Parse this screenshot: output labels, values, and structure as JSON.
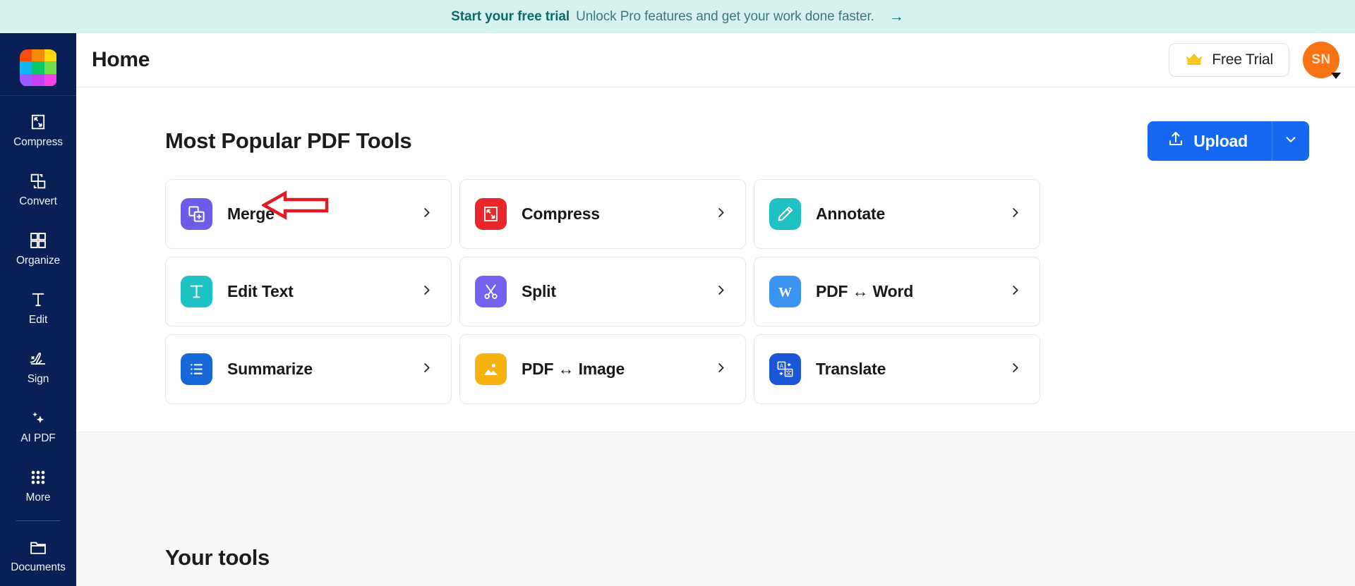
{
  "banner": {
    "strong": "Start your free trial",
    "text": "Unlock Pro features and get your work done faster.",
    "arrow": "→",
    "background": "#d6f2ef",
    "accent": "#0f6b63"
  },
  "header": {
    "title": "Home",
    "trial_label": "Free Trial",
    "trial_icon": "crown-icon",
    "avatar_initials": "SN",
    "avatar_color": "#f97316"
  },
  "sidebar": {
    "logo_name": "app-logo",
    "logo_colors": [
      "#f94d0c",
      "#f68b0b",
      "#ffd910",
      "#12b5f0",
      "#0bc964",
      "#74da49",
      "#9b5cff",
      "#c740f5",
      "#f941e6"
    ],
    "items": [
      {
        "label": "Compress",
        "icon": "compress-icon"
      },
      {
        "label": "Convert",
        "icon": "convert-icon"
      },
      {
        "label": "Organize",
        "icon": "organize-icon"
      },
      {
        "label": "Edit",
        "icon": "edit-text-icon"
      },
      {
        "label": "Sign",
        "icon": "signature-icon"
      },
      {
        "label": "AI PDF",
        "icon": "sparkles-icon"
      },
      {
        "label": "More",
        "icon": "grid-dots-icon"
      }
    ],
    "footer_items": [
      {
        "label": "Documents",
        "icon": "folder-icon"
      }
    ],
    "background": "#0a1f56"
  },
  "main": {
    "section_title": "Most Popular PDF Tools",
    "upload_label": "Upload",
    "upload_icon": "upload-icon",
    "upload_caret_icon": "chevron-down-icon",
    "upload_color": "#1668f0",
    "lower_section_title": "Your tools",
    "tools": [
      {
        "label": "Merge",
        "icon": "merge-icon",
        "color": "#6c5ce7",
        "chevron": "chevron-right-icon"
      },
      {
        "label": "Compress",
        "icon": "compress-icon",
        "color": "#e8262b",
        "chevron": "chevron-right-icon"
      },
      {
        "label": "Annotate",
        "icon": "pencil-icon",
        "color": "#1fc2c2",
        "chevron": "chevron-right-icon"
      },
      {
        "label": "Edit Text",
        "icon": "text-icon",
        "color": "#1fc2c2",
        "chevron": "chevron-right-icon"
      },
      {
        "label": "Split",
        "icon": "scissors-icon",
        "color": "#7461ee",
        "chevron": "chevron-right-icon"
      },
      {
        "label": "PDF ↔ Word",
        "icon": "word-icon",
        "color": "#3b93f2",
        "chevron": "chevron-right-icon"
      },
      {
        "label": "Summarize",
        "icon": "list-icon",
        "color": "#1668d6",
        "chevron": "chevron-right-icon"
      },
      {
        "label": "PDF ↔ Image",
        "icon": "image-icon",
        "color": "#f7b211",
        "chevron": "chevron-right-icon"
      },
      {
        "label": "Translate",
        "icon": "translate-icon",
        "color": "#1a56d6",
        "chevron": "chevron-right-icon"
      }
    ]
  },
  "annotation": {
    "type": "left-pointing-arrow",
    "color": "#e01b22",
    "points_at": "Merge"
  }
}
